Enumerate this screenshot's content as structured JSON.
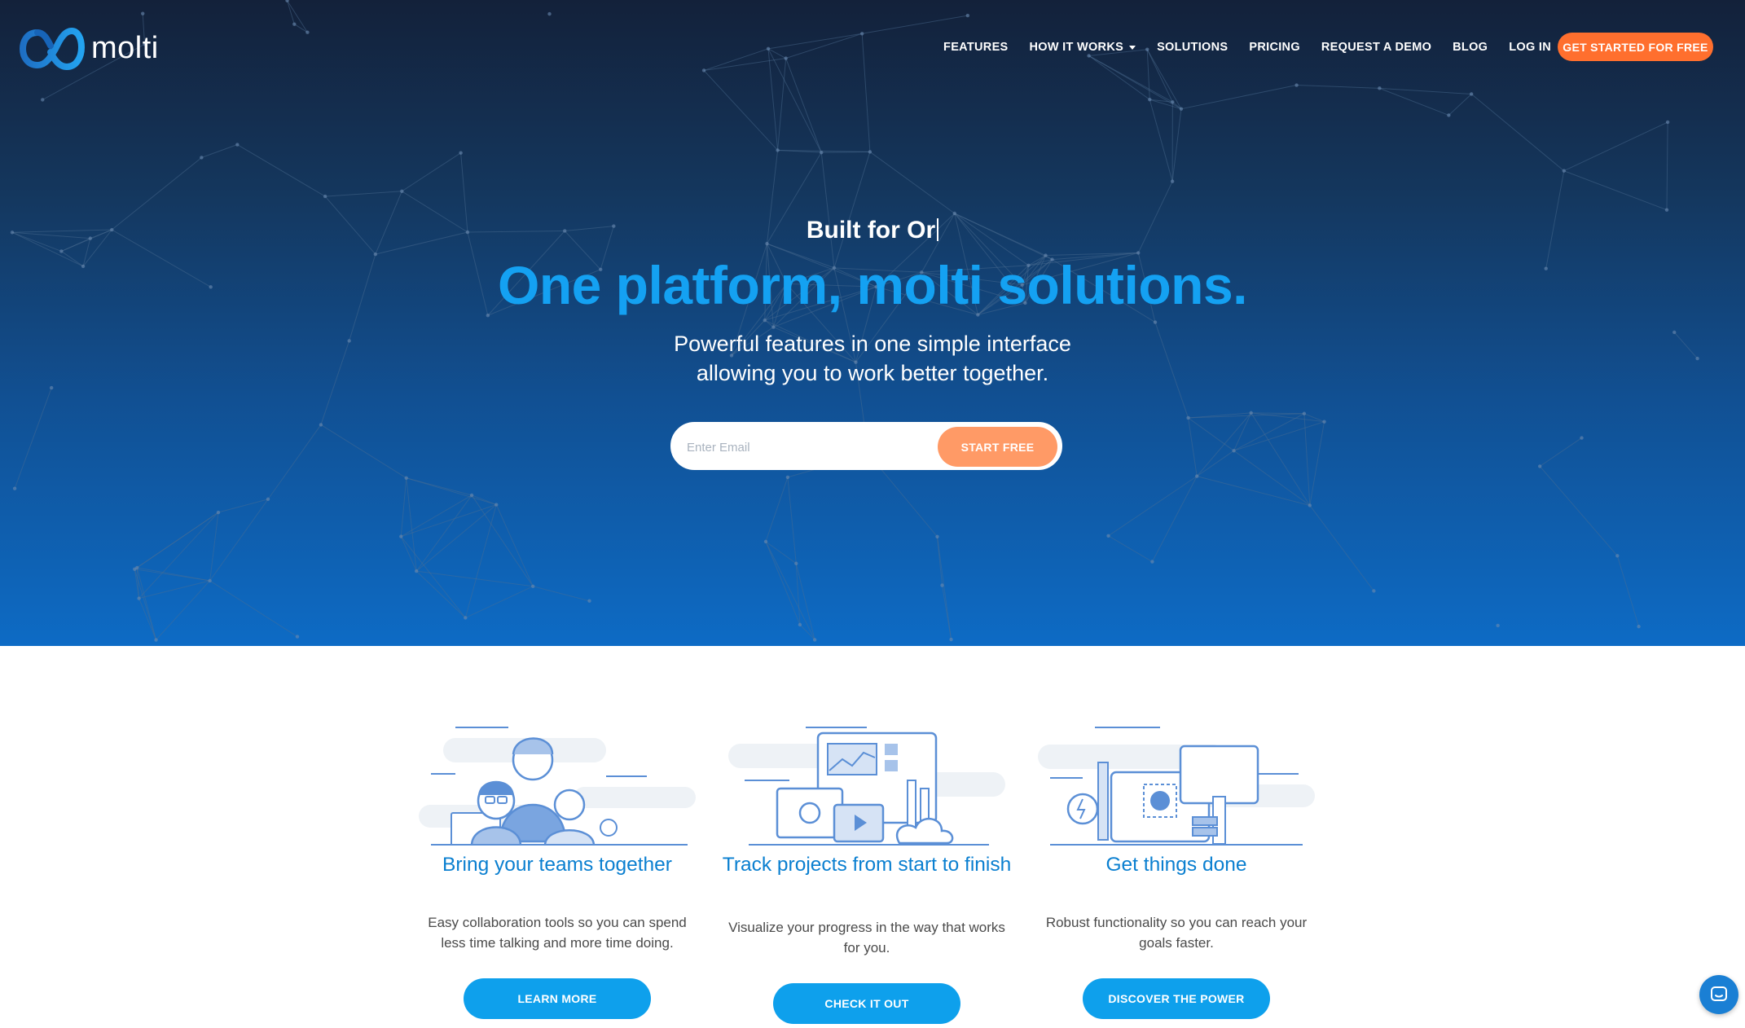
{
  "brand": {
    "name": "molti"
  },
  "nav": {
    "items": [
      "FEATURES",
      "HOW IT WORKS",
      "SOLUTIONS",
      "PRICING",
      "REQUEST A DEMO",
      "BLOG",
      "LOG IN"
    ],
    "cta": "GET STARTED FOR FREE"
  },
  "hero": {
    "kicker": "Built for Or",
    "headline": "One platform, molti solutions.",
    "subline_1": "Powerful features in one simple interface",
    "subline_2": "allowing you to work better together.",
    "email_placeholder": "Enter Email",
    "start_label": "START FREE"
  },
  "features": [
    {
      "title": "Bring your teams together",
      "text": "Easy collaboration tools so you can spend less time talking and more time doing.",
      "button": "LEARN MORE"
    },
    {
      "title": "Track projects from start to finish",
      "text": "Visualize your progress in the way that works for you.",
      "button": "CHECK IT OUT"
    },
    {
      "title": "Get things done",
      "text": "Robust functionality so you can reach your goals faster.",
      "button": "DISCOVER THE POWER"
    }
  ],
  "colors": {
    "accent_orange": "#ff6f2e",
    "headline_blue": "#14a1f2",
    "button_blue": "#0ea0ec",
    "hero_dark": "#13213a"
  },
  "icons": [
    "molti-logo-icon",
    "caret-down-icon",
    "chat-icon"
  ]
}
